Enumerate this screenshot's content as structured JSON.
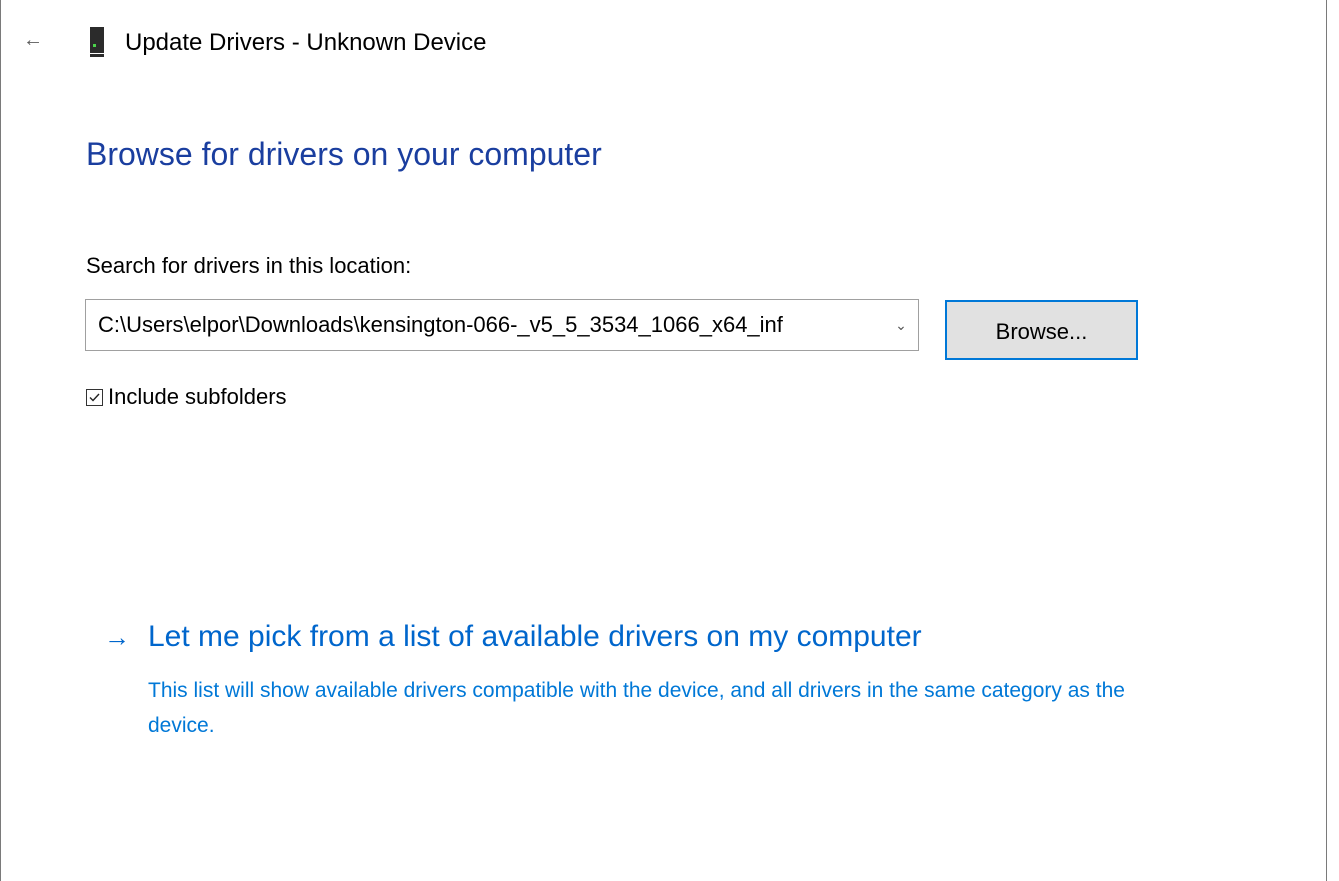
{
  "header": {
    "back_icon": "back-arrow-icon",
    "device_icon": "device-icon",
    "window_title": "Update Drivers - Unknown Device"
  },
  "main": {
    "page_title": "Browse for drivers on your computer",
    "location_label": "Search for drivers in this location:",
    "path_value": "C:\\Users\\elpor\\Downloads\\kensington-066-_v5_5_3534_1066_x64_inf",
    "browse_label": "Browse...",
    "include_subfolders": {
      "label": "Include subfolders",
      "checked": true
    },
    "pick_link": {
      "label": "Let me pick from a list of available drivers on my computer",
      "description": "This list will show available drivers compatible with the device, and all drivers in the same category as the device."
    }
  },
  "colors": {
    "title_blue": "#1a3e9f",
    "link_blue": "#0066cc",
    "focus_border": "#0078d7",
    "button_bg": "#e1e1e1"
  }
}
